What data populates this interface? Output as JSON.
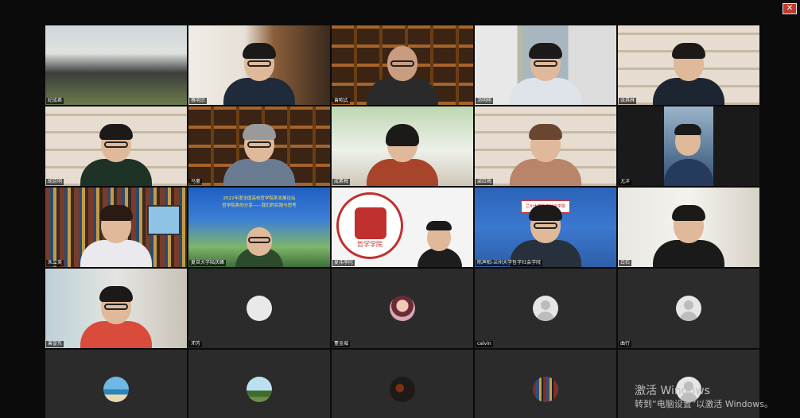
{
  "window": {
    "close_label": "✕"
  },
  "participants": [
    {
      "name": "纪成君"
    },
    {
      "name": "蔡明宗"
    },
    {
      "name": "曾昭式"
    },
    {
      "name": "汤明翔"
    },
    {
      "name": "张其林"
    },
    {
      "name": "胡京明"
    },
    {
      "name": "马豪"
    },
    {
      "name": "成素梅"
    },
    {
      "name": "梁红梅"
    },
    {
      "name": "尤洋"
    },
    {
      "name": "朱立英"
    },
    {
      "name": "复旦大学陆庆峰"
    },
    {
      "name": "夏伟李陀"
    },
    {
      "name": "陈声柏-兰州大学哲学社会学院"
    },
    {
      "name": "白石"
    },
    {
      "name": "曾望东"
    },
    {
      "name": "沛芳"
    },
    {
      "name": "董金城"
    },
    {
      "name": "calvin"
    },
    {
      "name": "曲行"
    },
    {
      "name": ""
    },
    {
      "name": ""
    },
    {
      "name": ""
    },
    {
      "name": ""
    },
    {
      "name": ""
    }
  ],
  "slide": {
    "line1": "2022年度全国高校哲学院系发展论坛",
    "line2": "哲学院系的分享——我们的实践与思考"
  },
  "seal": {
    "text": "哲学学院"
  },
  "lzu_logo": "兰州大学哲学社会学院",
  "activation": {
    "line1": "激活 Windows",
    "line2": "转到“电脑设置”以激活 Windows。"
  },
  "colors": {
    "background": "#0b0b0b",
    "tile": "#2b2b2b",
    "close": "#c0392b"
  }
}
